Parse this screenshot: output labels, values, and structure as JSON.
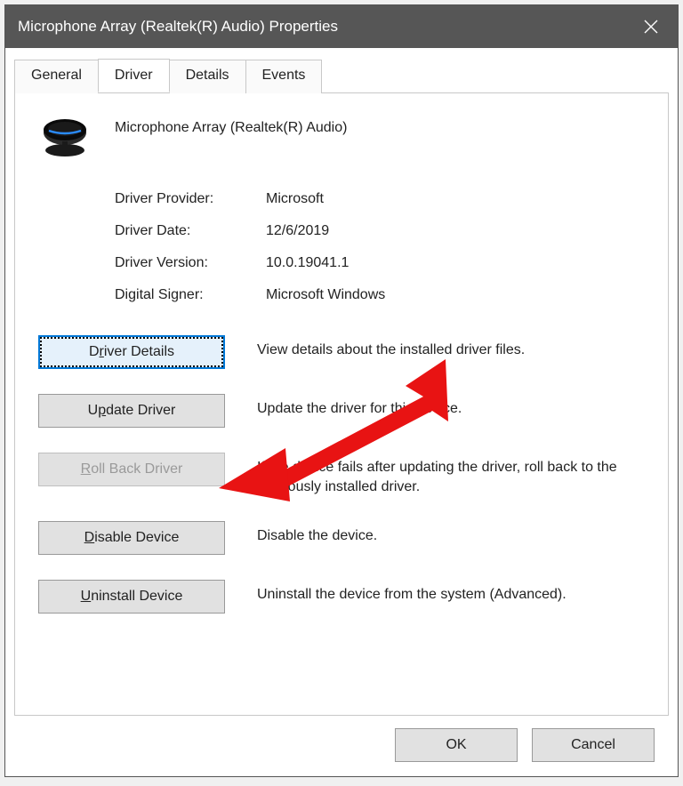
{
  "titlebar": {
    "title": "Microphone Array (Realtek(R) Audio) Properties"
  },
  "tabs": {
    "general": "General",
    "driver": "Driver",
    "details": "Details",
    "events": "Events"
  },
  "device": {
    "name": "Microphone Array (Realtek(R) Audio)"
  },
  "info": {
    "provider_label": "Driver Provider:",
    "provider_value": "Microsoft",
    "date_label": "Driver Date:",
    "date_value": "12/6/2019",
    "version_label": "Driver Version:",
    "version_value": "10.0.19041.1",
    "signer_label": "Digital Signer:",
    "signer_value": "Microsoft Windows"
  },
  "actions": {
    "details_btn_pre": "D",
    "details_btn_u": "r",
    "details_btn_post": "iver Details",
    "details_desc": "View details about the installed driver files.",
    "update_btn_pre": "U",
    "update_btn_u": "p",
    "update_btn_post": "date Driver",
    "update_desc": "Update the driver for this device.",
    "rollback_btn_pre": "",
    "rollback_btn_u": "R",
    "rollback_btn_post": "oll Back Driver",
    "rollback_desc": "If the device fails after updating the driver, roll back to the previously installed driver.",
    "disable_btn_pre": "",
    "disable_btn_u": "D",
    "disable_btn_post": "isable Device",
    "disable_desc": "Disable the device.",
    "uninstall_btn_pre": "",
    "uninstall_btn_u": "U",
    "uninstall_btn_post": "ninstall Device",
    "uninstall_desc": "Uninstall the device from the system (Advanced)."
  },
  "dialog": {
    "ok": "OK",
    "cancel": "Cancel"
  }
}
